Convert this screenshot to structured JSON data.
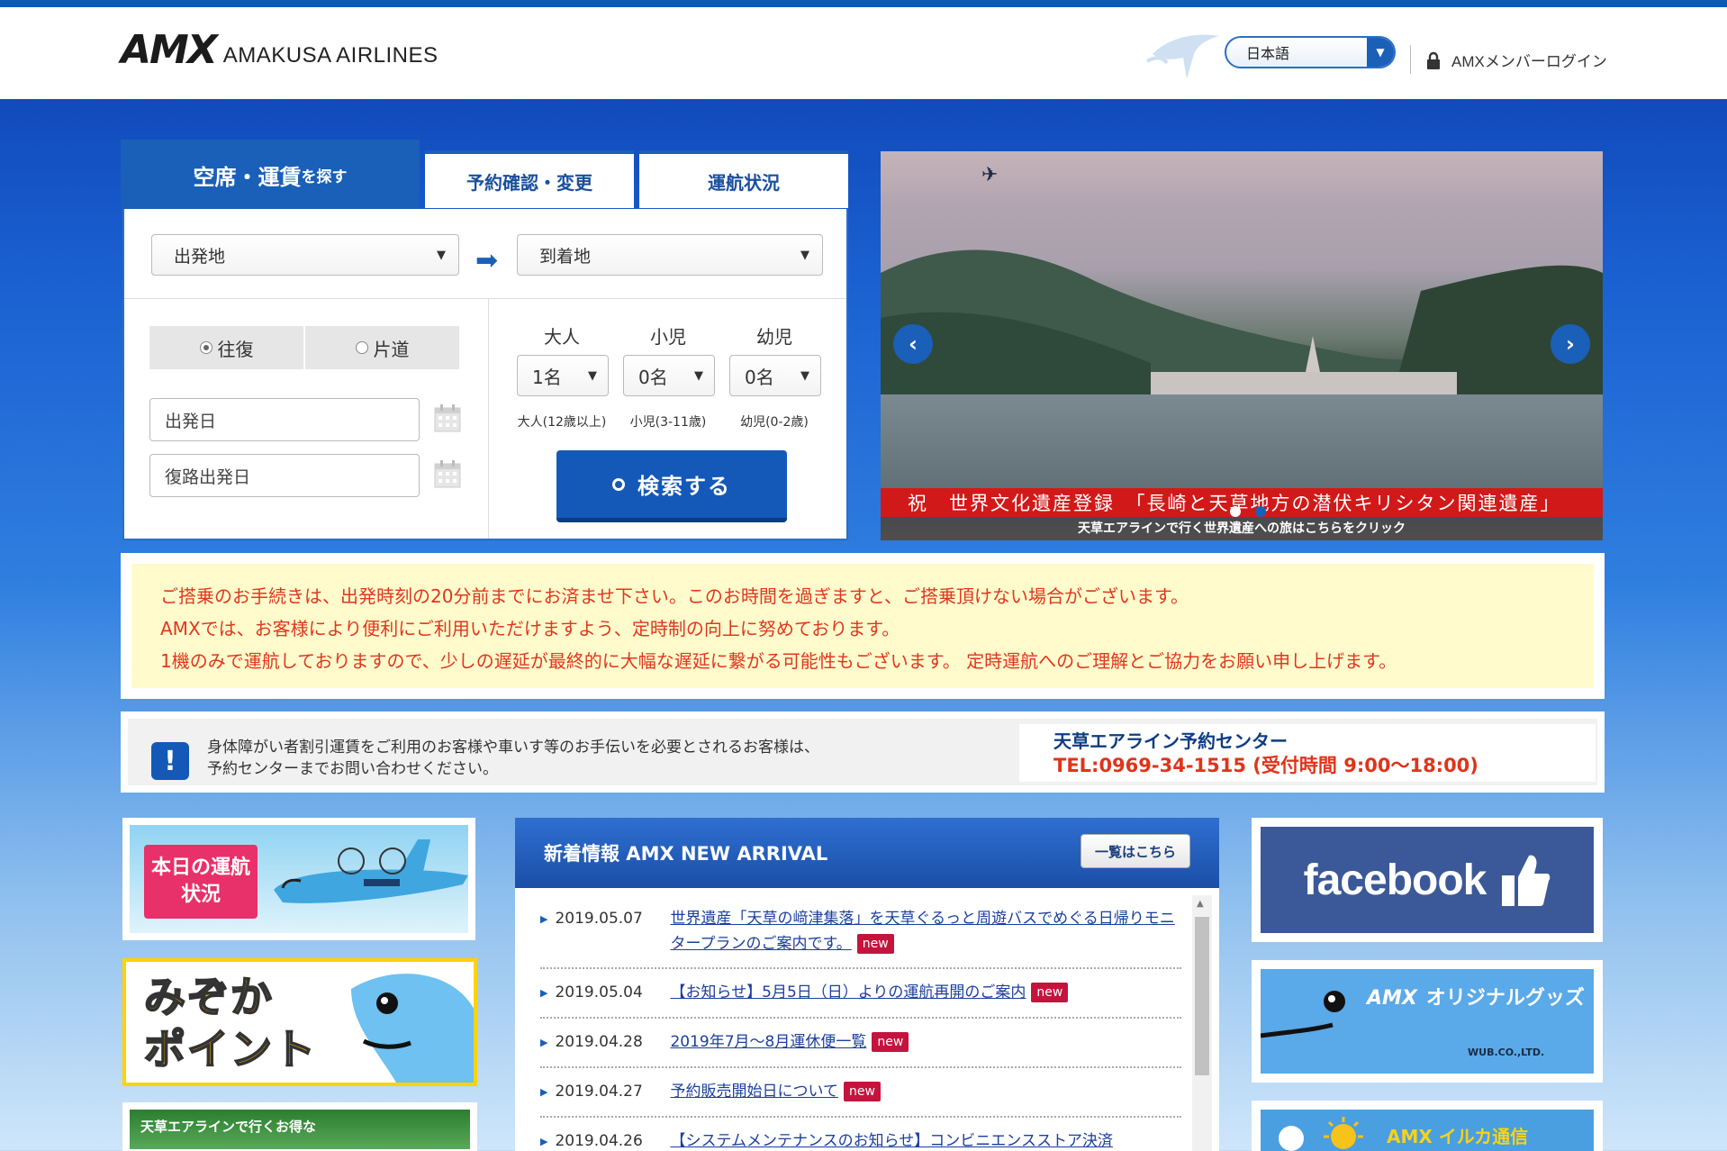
{
  "header": {
    "logo_mark": "AMX",
    "logo_text": "AMAKUSA AIRLINES",
    "language": "日本語",
    "login_label": "AMXメンバーログイン"
  },
  "search": {
    "tabs": {
      "active_main": "空席・運賃",
      "active_suffix": "を探す",
      "reservation": "予約確認・変更",
      "status": "運航状況"
    },
    "origin": "出発地",
    "destination": "到着地",
    "trip_roundtrip": "往復",
    "trip_oneway": "片道",
    "depart_date": "出発日",
    "return_date": "復路出発日",
    "pax": {
      "adult_label": "大人",
      "child_label": "小児",
      "infant_label": "幼児",
      "adult_value": "1名",
      "child_value": "0名",
      "infant_value": "0名",
      "adult_note": "大人(12歳以上)",
      "child_note": "小児(3-11歳)",
      "infant_note": "幼児(0-2歳)"
    },
    "button": "検索する"
  },
  "slideshow": {
    "caption": "祝　世界文化遺産登録　「長崎と天草地方の潜伏キリシタン関連遺産」",
    "subcaption": "天草エアラインで行く世界遺産への旅はこちらをクリック"
  },
  "notice": {
    "line1": "ご搭乗のお手続きは、出発時刻の20分前までにお済ませ下さい。このお時間を過ぎますと、ご搭乗頂けない場合がございます。",
    "line2": "AMXでは、お客様により便利にご利用いただけますよう、定時制の向上に努めております。",
    "line3": "1機のみで運航しておりますので、少しの遅延が最終的に大幅な遅延に繋がる可能性もございます。 定時運航へのご理解とご協力をお願い申し上げます。"
  },
  "info": {
    "line1": "身体障がい者割引運賃をご利用のお客様や車いす等のお手伝いを必要とされるお客様は、",
    "line2": "予約センターまでお問い合わせください。",
    "center_title": "天草エアライン予約センター",
    "center_tel": "TEL:0969-34-1515 (受付時間 9:00〜18:00)"
  },
  "left_banners": {
    "status_label": "本日の運航状況",
    "mizoka_line1": "みぞか",
    "mizoka_line2": "ポイント",
    "deal_label": "天草エアラインで行くお得な"
  },
  "news": {
    "heading": "新着情報 AMX NEW ARRIVAL",
    "more": "一覧はこちら",
    "new_label": "new",
    "items": [
      {
        "date": "2019.05.07",
        "title": "世界遺産「天草の﨑津集落」を天草ぐるっと周遊バスでめぐる日帰りモニタープランのご案内です。"
      },
      {
        "date": "2019.05.04",
        "title": "【お知らせ】5月5日（日）よりの運航再開のご案内"
      },
      {
        "date": "2019.04.28",
        "title": "2019年7月〜8月運休便一覧"
      },
      {
        "date": "2019.04.27",
        "title": "予約販売開始日について"
      },
      {
        "date": "2019.04.26",
        "title": "【システムメンテナンスのお知らせ】コンビニエンスストア決済"
      }
    ]
  },
  "right_banners": {
    "facebook": "facebook",
    "goods_brand": "AMX",
    "goods_label": "オリジナルグッズ",
    "goods_sub": "WUB.CO.,LTD.",
    "iruka_label": "AMX イルカ通信"
  }
}
